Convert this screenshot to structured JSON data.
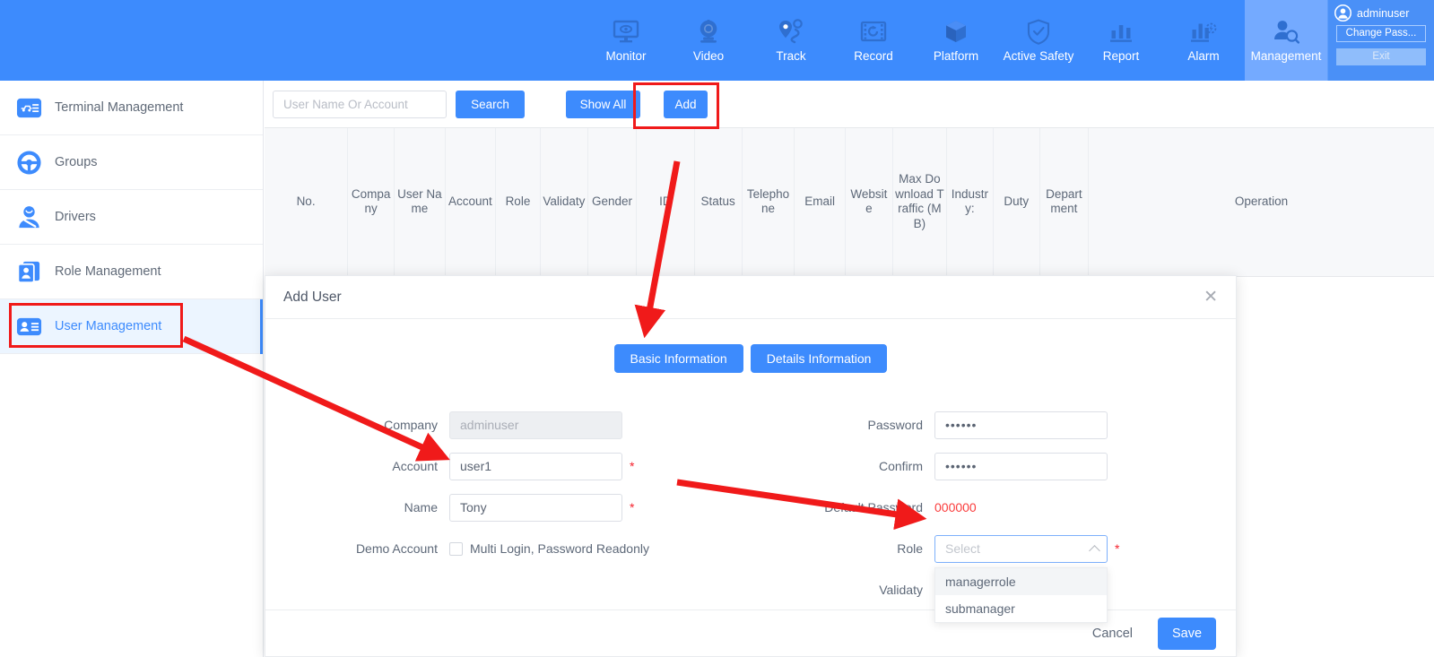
{
  "topnav": {
    "items": [
      {
        "label": "Monitor",
        "icon": "monitor-icon"
      },
      {
        "label": "Video",
        "icon": "camera-icon"
      },
      {
        "label": "Track",
        "icon": "track-icon"
      },
      {
        "label": "Record",
        "icon": "record-icon"
      },
      {
        "label": "Platform",
        "icon": "cube-icon"
      },
      {
        "label": "Active Safety",
        "icon": "shield-check-icon"
      },
      {
        "label": "Report",
        "icon": "bar-chart-icon"
      },
      {
        "label": "Alarm",
        "icon": "alarm-chart-icon"
      },
      {
        "label": "Management",
        "icon": "user-search-icon"
      }
    ],
    "active": "Management",
    "user": {
      "name": "adminuser",
      "change_password_label": "Change Pass...",
      "exit_label": "Exit"
    },
    "accent": "#3d8bfd",
    "active_bg": "#74aaff"
  },
  "sidebar": {
    "items": [
      {
        "label": "Terminal Management",
        "icon": "terminal-card-icon"
      },
      {
        "label": "Groups",
        "icon": "steering-wheel-icon"
      },
      {
        "label": "Drivers",
        "icon": "driver-person-icon"
      },
      {
        "label": "Role Management",
        "icon": "role-card-icon"
      },
      {
        "label": "User Management",
        "icon": "user-card-icon"
      }
    ],
    "active": "User Management"
  },
  "toolbar": {
    "search_placeholder": "User Name Or Account",
    "search_value": "",
    "search_label": "Search",
    "show_all_label": "Show All",
    "add_label": "Add"
  },
  "table": {
    "columns": [
      "No.",
      "Company",
      "User Name",
      "Account",
      "Role",
      "Validaty",
      "Gender",
      "ID",
      "Status",
      "Telephone",
      "Email",
      "Website",
      "Max Download Traffic (MB)",
      "Industry:",
      "Duty",
      "Department",
      "Operation"
    ],
    "rows": []
  },
  "modal": {
    "title": "Add User",
    "close_icon": "close-icon",
    "tabs": [
      {
        "label": "Basic Information",
        "active": true
      },
      {
        "label": "Details Information",
        "active": false
      }
    ],
    "fields": {
      "company_label": "Company",
      "company_value": "adminuser",
      "account_label": "Account",
      "account_value": "user1",
      "name_label": "Name",
      "name_value": "Tony",
      "demo_account_label": "Demo Account",
      "demo_account_checkbox_label": "Multi Login, Password Readonly",
      "demo_account_checked": false,
      "password_label": "Password",
      "password_value": "••••••",
      "confirm_label": "Confirm",
      "confirm_value": "••••••",
      "default_password_label": "Default Password",
      "default_password_value": "000000",
      "default_password_color": "#fa3c3c",
      "role_label": "Role",
      "role_placeholder": "Select",
      "role_value": "",
      "validaty_label": "Validaty",
      "required_marker": "*"
    },
    "role_options": [
      {
        "label": "managerrole",
        "highlighted": true
      },
      {
        "label": "submanager",
        "highlighted": false
      }
    ],
    "footer": {
      "cancel_label": "Cancel",
      "save_label": "Save"
    }
  },
  "annotations": {
    "highlight_color": "#f01a1a",
    "boxes": [
      "add-button",
      "user-management-sidebar-item"
    ],
    "arrows": [
      "arrow-to-basic-information-tab",
      "arrow-to-name-field",
      "arrow-to-role-select"
    ]
  }
}
